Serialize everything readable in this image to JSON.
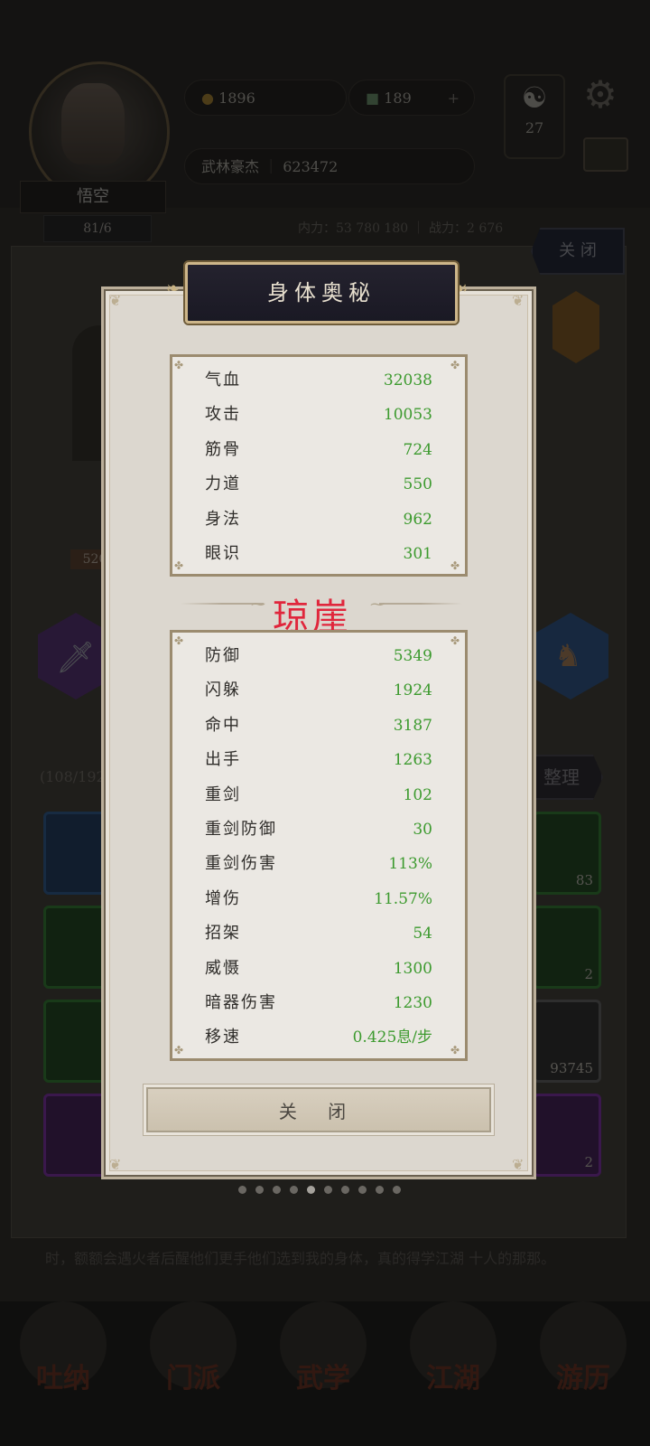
{
  "background": {
    "player_name": "悟空",
    "player_level": "81/6",
    "gold": "1896",
    "ticket": "189",
    "rank_title": "武林豪杰",
    "rank_value": "623472",
    "taiji_count": "27",
    "stats_strip": "内力：53 780 180  ｜  战力：2 676",
    "close_label": "关 闭",
    "inventory_count": "(108/192",
    "arrange_label": "整理",
    "weapon_value": "520",
    "slot_counts": [
      "83",
      "2",
      "93745",
      "2"
    ],
    "bottom_text": "时，额额会遇火者后醒他们更手他们选到我的身体，真的得学江湖 十人的那那。",
    "nav": [
      "吐纳",
      "门派",
      "武学",
      "江湖",
      "游历"
    ]
  },
  "modal": {
    "title": "身体奥秘",
    "watermark": "琼崖",
    "close_label": "关 闭",
    "pagination": {
      "total": 10,
      "active": 4
    },
    "primary_stats": [
      {
        "label": "气血",
        "value": "32038"
      },
      {
        "label": "攻击",
        "value": "10053"
      },
      {
        "label": "筋骨",
        "value": "724"
      },
      {
        "label": "力道",
        "value": "550"
      },
      {
        "label": "身法",
        "value": "962"
      },
      {
        "label": "眼识",
        "value": "301"
      }
    ],
    "secondary_stats": [
      {
        "label": "防御",
        "value": "5349"
      },
      {
        "label": "闪躲",
        "value": "1924"
      },
      {
        "label": "命中",
        "value": "3187"
      },
      {
        "label": "出手",
        "value": "1263"
      },
      {
        "label": "重剑",
        "value": "102"
      },
      {
        "label": "重剑防御",
        "value": "30"
      },
      {
        "label": "重剑伤害",
        "value": "113%"
      },
      {
        "label": "增伤",
        "value": "11.57%"
      },
      {
        "label": "招架",
        "value": "54"
      },
      {
        "label": "威慑",
        "value": "1300"
      },
      {
        "label": "暗器伤害",
        "value": "1230"
      },
      {
        "label": "移速",
        "value": "0.425息/步"
      }
    ]
  },
  "colors": {
    "stat_value": "#3c9a2e",
    "watermark": "#e0263c",
    "modal_bg": "#dcd7cf",
    "title_plate": "#1f1e29"
  }
}
